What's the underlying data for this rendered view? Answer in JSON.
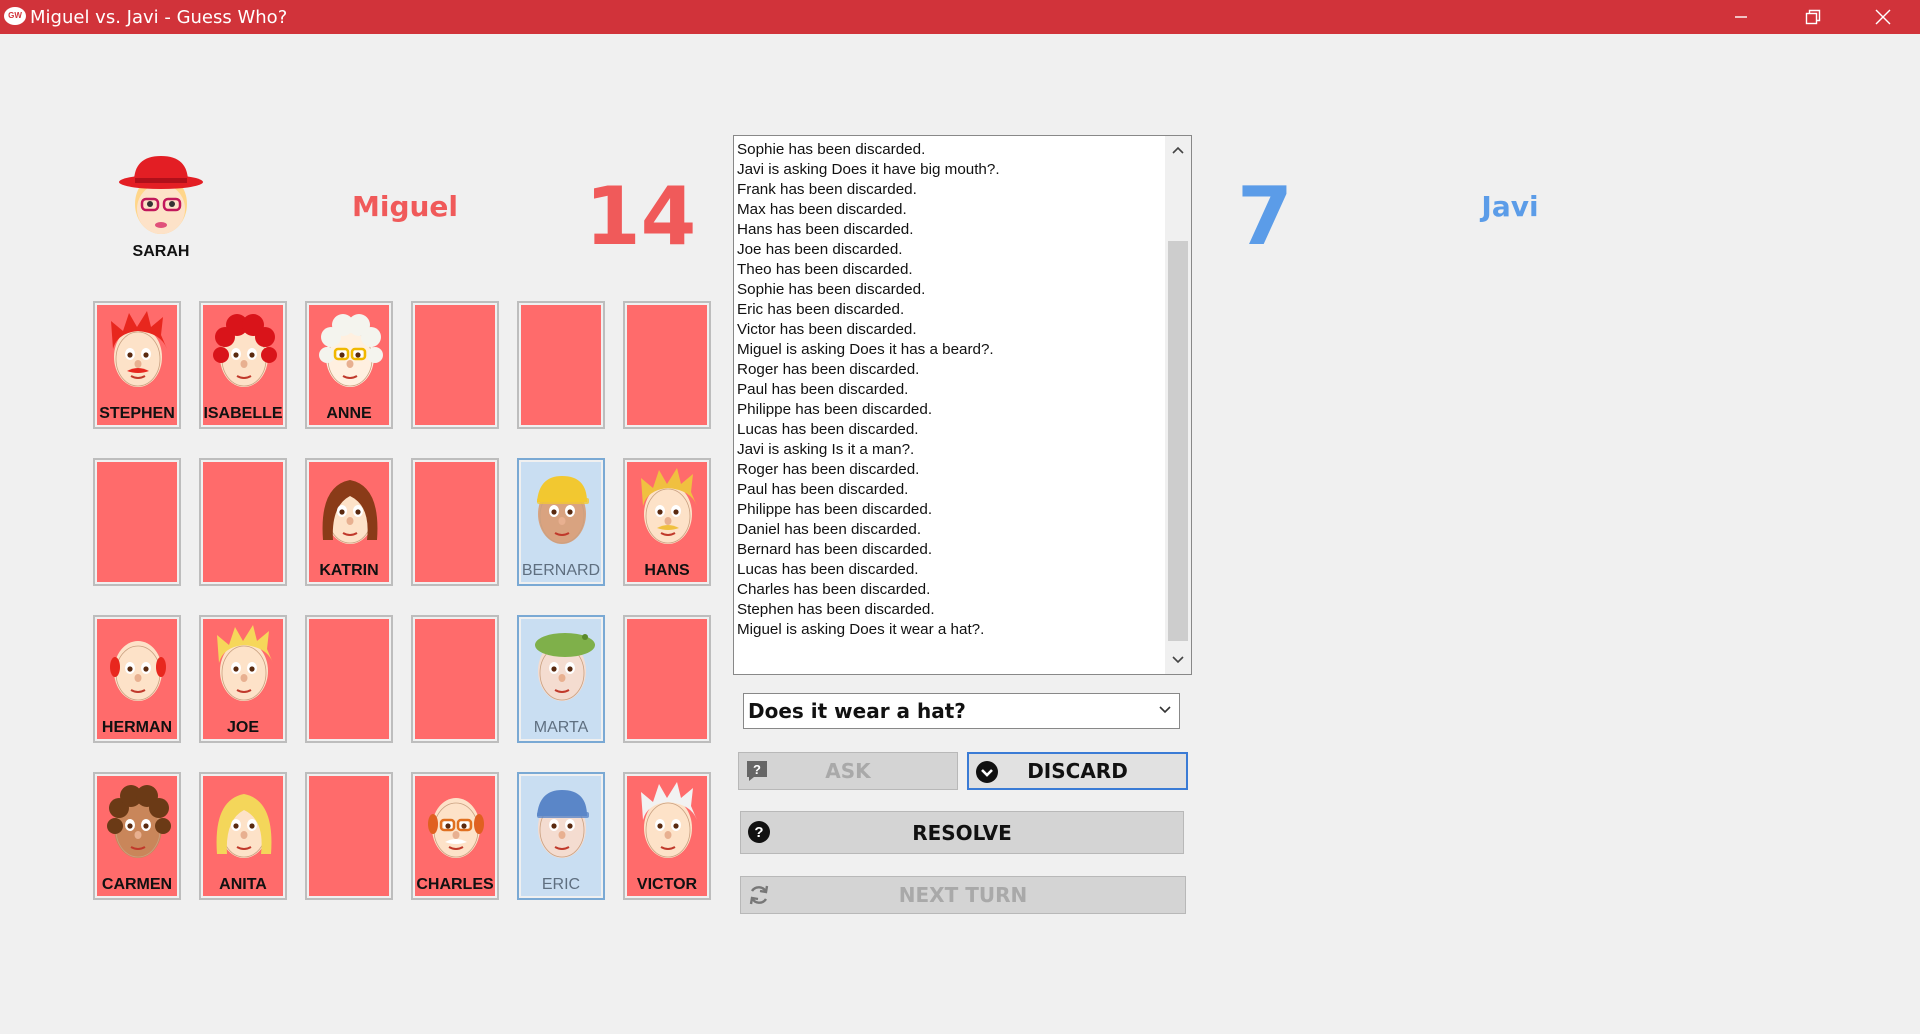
{
  "window": {
    "title": "Miguel vs. Javi - Guess Who?",
    "icon_label": "GW"
  },
  "player1": {
    "name": "Miguel",
    "score": "14",
    "secret_card": "SARAH",
    "color": "#f05a5a"
  },
  "player2": {
    "name": "Javi",
    "score": "7",
    "color": "#5b9ce8"
  },
  "board": {
    "rows": [
      [
        {
          "name": "STEPHEN",
          "state": "face",
          "face": "stephen"
        },
        {
          "name": "ISABELLE",
          "state": "face",
          "face": "isabelle"
        },
        {
          "name": "ANNE",
          "state": "face",
          "face": "anne"
        },
        {
          "name": "",
          "state": "empty"
        },
        {
          "name": "",
          "state": "empty"
        },
        {
          "name": "",
          "state": "empty"
        }
      ],
      [
        {
          "name": "",
          "state": "empty"
        },
        {
          "name": "",
          "state": "empty"
        },
        {
          "name": "KATRIN",
          "state": "face",
          "face": "katrin"
        },
        {
          "name": "",
          "state": "empty"
        },
        {
          "name": "BERNARD",
          "state": "highlight",
          "face": "bernard"
        },
        {
          "name": "HANS",
          "state": "face",
          "face": "hans"
        }
      ],
      [
        {
          "name": "HERMAN",
          "state": "face",
          "face": "herman"
        },
        {
          "name": "JOE",
          "state": "face",
          "face": "joe"
        },
        {
          "name": "",
          "state": "empty"
        },
        {
          "name": "",
          "state": "empty"
        },
        {
          "name": "MARTA",
          "state": "highlight",
          "face": "marta"
        },
        {
          "name": "",
          "state": "empty"
        }
      ],
      [
        {
          "name": "CARMEN",
          "state": "face",
          "face": "carmen"
        },
        {
          "name": "ANITA",
          "state": "face",
          "face": "anita"
        },
        {
          "name": "",
          "state": "empty"
        },
        {
          "name": "CHARLES",
          "state": "face",
          "face": "charles"
        },
        {
          "name": "ERIC",
          "state": "highlight",
          "face": "eric"
        },
        {
          "name": "VICTOR",
          "state": "face",
          "face": "victor"
        }
      ]
    ]
  },
  "log": [
    "Sophie has been discarded.",
    "Javi is asking Does it have big mouth?.",
    "Frank has been discarded.",
    "Max has been discarded.",
    "Hans has been discarded.",
    "Joe has been discarded.",
    "Theo has been discarded.",
    "Sophie has been discarded.",
    "Eric has been discarded.",
    "Victor has been discarded.",
    "Miguel is asking Does it has a beard?.",
    "Roger has been discarded.",
    "Paul has been discarded.",
    "Philippe has been discarded.",
    "Lucas has been discarded.",
    "Javi is asking Is it a man?.",
    "Roger has been discarded.",
    "Paul has been discarded.",
    "Philippe has been discarded.",
    "Daniel has been discarded.",
    "Bernard has been discarded.",
    "Lucas has been discarded.",
    "Charles has been discarded.",
    "Stephen has been discarded.",
    "Miguel is asking Does it wear a hat?."
  ],
  "question_select": {
    "selected": "Does it wear a hat?"
  },
  "buttons": {
    "ask": "ASK",
    "discard": "DISCARD",
    "resolve": "RESOLVE",
    "next_turn": "NEXT TURN"
  },
  "icons": {
    "ask": "question-bubble-icon",
    "discard": "check-circle-icon",
    "resolve": "question-circle-icon",
    "next_turn": "refresh-icon"
  }
}
